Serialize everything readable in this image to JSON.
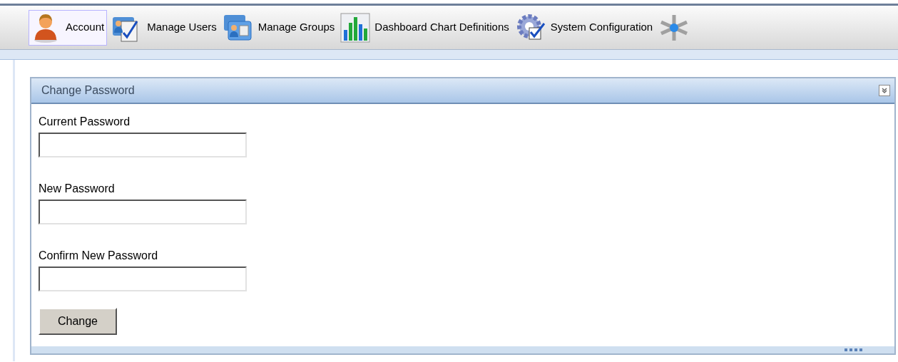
{
  "toolbar": {
    "tabs": [
      {
        "kind": "person",
        "label": "Account",
        "selected": true
      },
      {
        "kind": "users",
        "label": "Manage Users",
        "selected": false
      },
      {
        "kind": "groups",
        "label": "Manage Groups",
        "selected": false
      },
      {
        "kind": "chart",
        "label": "Dashboard Chart Definitions",
        "selected": false
      },
      {
        "kind": "config",
        "label": "System Configuration",
        "selected": false
      },
      {
        "kind": "network",
        "selected": false
      }
    ]
  },
  "panel": {
    "title": "Change Password",
    "fields": [
      {
        "label": "Current Password"
      },
      {
        "label": "New Password"
      },
      {
        "label": "Confirm New Password"
      }
    ],
    "button": "Change"
  }
}
